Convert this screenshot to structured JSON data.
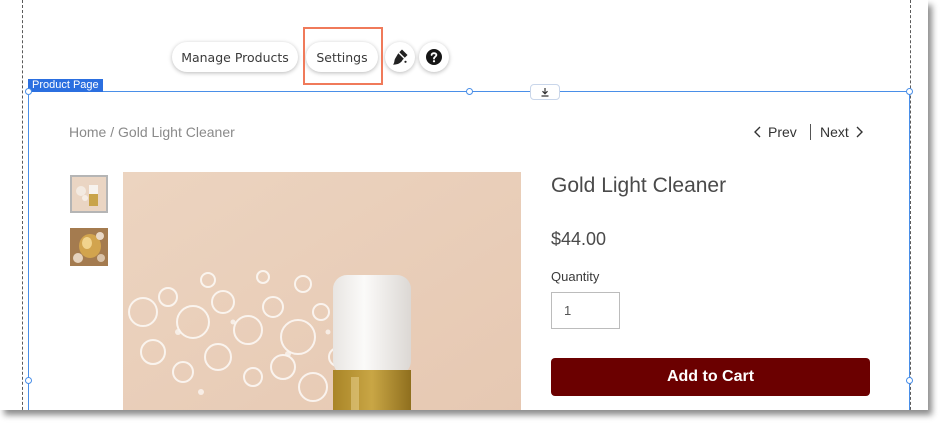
{
  "toolbar": {
    "manage_products_label": "Manage Products",
    "settings_label": "Settings",
    "design_icon": "paint-brush-icon",
    "help_icon": "question-icon"
  },
  "section": {
    "label": "Product Page",
    "anchor_icon": "download-arrow-icon"
  },
  "breadcrumb": {
    "home": "Home",
    "separator": " / ",
    "current": "Gold Light Cleaner"
  },
  "pager": {
    "prev_label": "Prev",
    "next_label": "Next"
  },
  "product": {
    "title": "Gold Light Cleaner",
    "price": "$44.00",
    "quantity_label": "Quantity",
    "quantity_value": "1",
    "add_to_cart_label": "Add to Cart"
  },
  "colors": {
    "selection_blue": "#4a8fe8",
    "label_blue": "#2b6fe0",
    "highlight": "#f07a5a",
    "add_to_cart": "#6b0000"
  }
}
